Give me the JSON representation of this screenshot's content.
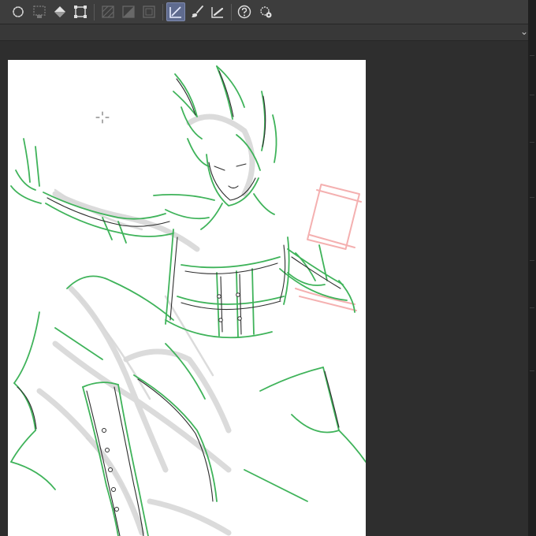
{
  "app": {
    "tools": [
      {
        "name": "auto-select",
        "icon": "auto-select-icon"
      },
      {
        "name": "select-layer",
        "icon": "select-layer-icon"
      },
      {
        "name": "fill",
        "icon": "fill-bucket-icon"
      },
      {
        "name": "transform",
        "icon": "transform-icon"
      },
      {
        "name": "ruler-perspective",
        "icon": "ruler-perspective-icon"
      },
      {
        "name": "gradient",
        "icon": "gradient-icon"
      },
      {
        "name": "frame-border",
        "icon": "frame-border-icon"
      },
      {
        "name": "vector-line",
        "icon": "vector-line-icon",
        "active": true
      },
      {
        "name": "brush",
        "icon": "brush-icon"
      },
      {
        "name": "pen-pressure",
        "icon": "pen-pressure-icon"
      },
      {
        "name": "help",
        "icon": "help-icon"
      },
      {
        "name": "settings",
        "icon": "settings-icon"
      }
    ],
    "colors": {
      "toolbar_bg": "#3d3d3d",
      "workspace_bg": "#2e2e2e",
      "canvas_bg": "#ffffff",
      "active_tool": "#5f6b8f",
      "line_green": "#3fb35a",
      "line_dark": "#2a2a2a",
      "sketch_gray": "#c9c9c9",
      "sketch_red": "#f2a6a6"
    }
  }
}
